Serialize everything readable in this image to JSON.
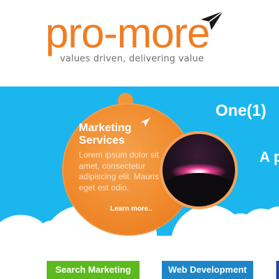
{
  "header": {
    "logo_text": "pro-more",
    "tagline": "values driven, delivering value"
  },
  "hero": {
    "slide_title": "One(1)",
    "slide_subtitle": "A p",
    "feature": {
      "title_line1": "Marketing",
      "title_line2": "Services",
      "body": "Lorem ipsum dolor sit amet, consectetur adipiscing elit. Mauris eget est odio.",
      "more_label": "Learn more.."
    }
  },
  "nav": {
    "tabs": [
      {
        "label": "Search Marketing"
      },
      {
        "label": "Web Development"
      },
      {
        "label": ""
      }
    ]
  },
  "colors": {
    "brand_orange": "#f07d22",
    "hero_blue": "#1cb6ee",
    "tab_green": "#5cb91e",
    "tab_blue": "#1d86c8",
    "tab_dark_blue": "#1d4aa6"
  },
  "icons": [
    "logo-arrow-icon",
    "small-arrow-icon"
  ]
}
